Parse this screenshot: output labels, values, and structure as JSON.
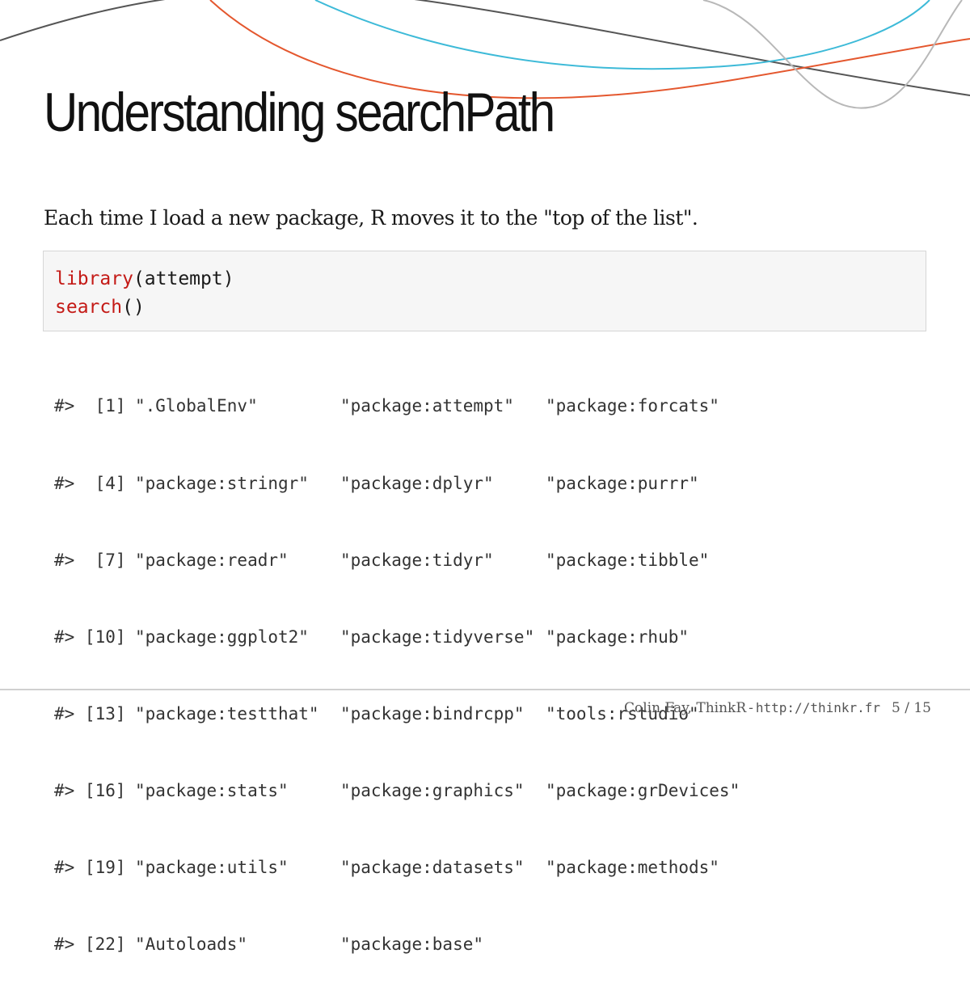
{
  "colors": {
    "decor_line_dark": "#555555",
    "decor_line_blue": "#3dbad8",
    "decor_line_orange": "#e4572e",
    "decor_line_gray": "#b8b8b8",
    "code_keyword": "#c41a16",
    "code_background": "#f6f6f6"
  },
  "slide": {
    "title": "Understanding searchPath",
    "intro": "Each time I load a new package, R moves it to the \"top of the list\"."
  },
  "code": {
    "line1": {
      "func": "library",
      "rest": "(attempt)"
    },
    "line2": {
      "func": "search",
      "rest": "()"
    }
  },
  "output": {
    "rows": [
      {
        "prefix": "#>  [1]",
        "values": [
          "\".GlobalEnv\"",
          "\"package:attempt\"",
          "\"package:forcats\""
        ]
      },
      {
        "prefix": "#>  [4]",
        "values": [
          "\"package:stringr\"",
          "\"package:dplyr\"",
          "\"package:purrr\""
        ]
      },
      {
        "prefix": "#>  [7]",
        "values": [
          "\"package:readr\"",
          "\"package:tidyr\"",
          "\"package:tibble\""
        ]
      },
      {
        "prefix": "#> [10]",
        "values": [
          "\"package:ggplot2\"",
          "\"package:tidyverse\"",
          "\"package:rhub\""
        ]
      },
      {
        "prefix": "#> [13]",
        "values": [
          "\"package:testthat\"",
          "\"package:bindrcpp\"",
          "\"tools:rstudio\""
        ]
      },
      {
        "prefix": "#> [16]",
        "values": [
          "\"package:stats\"",
          "\"package:graphics\"",
          "\"package:grDevices\""
        ]
      },
      {
        "prefix": "#> [19]",
        "values": [
          "\"package:utils\"",
          "\"package:datasets\"",
          "\"package:methods\""
        ]
      },
      {
        "prefix": "#> [22]",
        "values": [
          "\"Autoloads\"",
          "\"package:base\""
        ]
      }
    ]
  },
  "footer": {
    "author": "Colin Fay, ThinkR",
    "separator": "-",
    "url": "http://thinkr.fr",
    "page": "5 / 15"
  }
}
